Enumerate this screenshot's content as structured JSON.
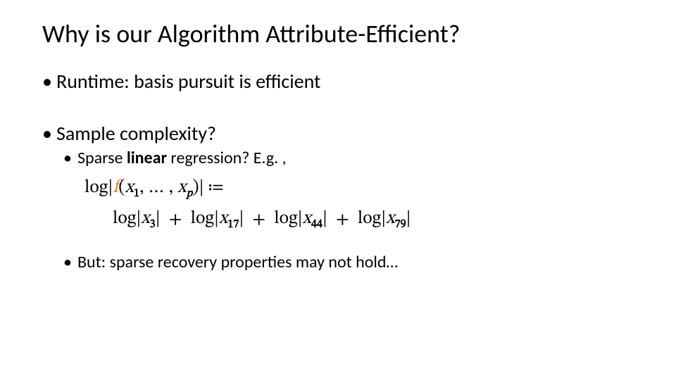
{
  "title": "Why is our Algorithm Attribute-Efficient?",
  "bullets": {
    "runtime": "Runtime: basis pursuit is efficient",
    "sample": "Sample complexity?",
    "sparse_prefix": "Sparse ",
    "sparse_bold": "linear",
    "sparse_suffix": " regression? E.g. ,",
    "but": "But: sparse recovery properties may not hold…"
  },
  "math": {
    "log": "log",
    "f": "f",
    "lparen": "(",
    "rparen": ")",
    "x": "x",
    "comma": ", ",
    "dots": "… ",
    "sub1": "1",
    "subp": "p",
    "defeq": " ≔",
    "abs_l": "|",
    "abs_r": "|",
    "plus": "+",
    "terms": [
      {
        "sub": "3"
      },
      {
        "sub": "17"
      },
      {
        "sub": "44"
      },
      {
        "sub": "79"
      }
    ]
  }
}
